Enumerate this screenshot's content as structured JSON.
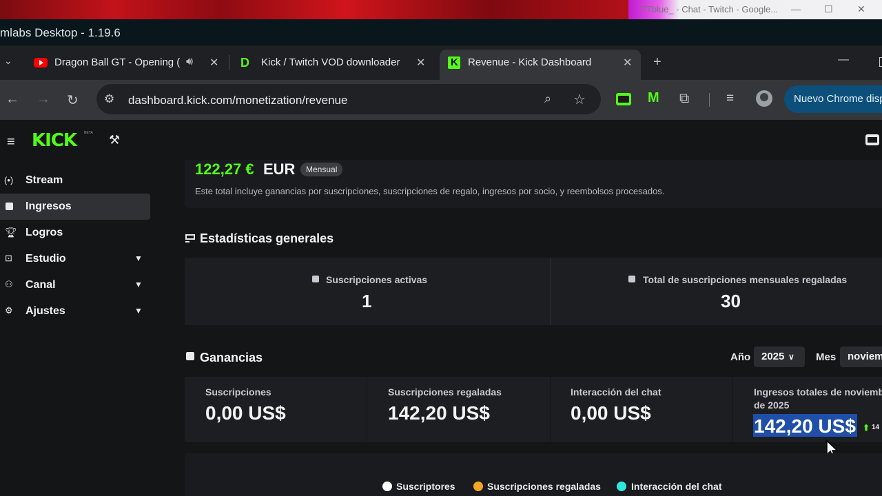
{
  "os": {
    "second_window_title": "TTblue_ - Chat - Twitch - Google..."
  },
  "app": {
    "title": "mlabs Desktop - 1.19.6"
  },
  "tabs": [
    {
      "label": "Dragon Ball GT - Opening (",
      "favicon": "youtube-icon",
      "active": false
    },
    {
      "label": "Kick / Twitch VOD downloader",
      "favicon": "d-logo-icon",
      "active": false
    },
    {
      "label": "Revenue - Kick Dashboard",
      "favicon": "kick-icon",
      "active": true
    }
  ],
  "toolbar": {
    "url": "dashboard.kick.com/monetization/revenue",
    "promo_button": "Nuevo Chrome disp"
  },
  "site": {
    "logo": "KICK",
    "beta": "BETA"
  },
  "sidebar": {
    "items": [
      {
        "label": "Stream",
        "icon": "broadcast-icon",
        "active": false,
        "expandable": false
      },
      {
        "label": "Ingresos",
        "icon": "chart-icon",
        "active": true,
        "expandable": false
      },
      {
        "label": "Logros",
        "icon": "trophy-icon",
        "active": false,
        "expandable": false
      },
      {
        "label": "Estudio",
        "icon": "studio-icon",
        "active": false,
        "expandable": true
      },
      {
        "label": "Canal",
        "icon": "channel-icon",
        "active": false,
        "expandable": true
      },
      {
        "label": "Ajustes",
        "icon": "gear-icon",
        "active": false,
        "expandable": true
      }
    ]
  },
  "revenue": {
    "amount": "122,27 €",
    "currency": "EUR",
    "period_badge": "Mensual",
    "note": "Este total incluye ganancias por suscripciones, suscripciones de regalo, ingresos por socio, y reembolsos procesados."
  },
  "stats": {
    "title": "Estadísticas generales",
    "cards": [
      {
        "label": "Suscripciones activas",
        "value": "1"
      },
      {
        "label": "Total de suscripciones mensuales regaladas",
        "value": "30"
      }
    ]
  },
  "earnings": {
    "title": "Ganancias",
    "year_label": "Año",
    "year_value": "2025",
    "month_label": "Mes",
    "month_value": "noviemb",
    "cards": [
      {
        "label": "Suscripciones",
        "value": "0,00 US$"
      },
      {
        "label": "Suscripciones regaladas",
        "value": "142,20 US$"
      },
      {
        "label": "Interacción del chat",
        "value": "0,00 US$"
      }
    ],
    "total": {
      "label_line1": "Ingresos totales de noviemb",
      "label_line2": "de 2025",
      "value": "142,20 US$",
      "change": "14"
    }
  },
  "legend": [
    {
      "label": "Suscriptores",
      "color": "#ffffff"
    },
    {
      "label": "Suscripciones regaladas",
      "color": "#f5a623"
    },
    {
      "label": "Interacción del chat",
      "color": "#2ee6e0"
    }
  ],
  "colors": {
    "kick_green": "#53fc18",
    "page_bg": "#141517",
    "selection": "#1f4fa8"
  }
}
